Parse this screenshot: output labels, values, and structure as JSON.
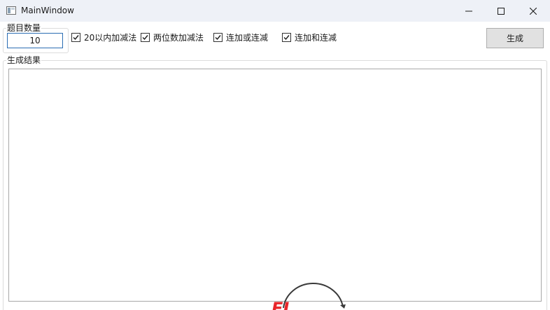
{
  "window": {
    "title": "MainWindow",
    "icon": "app-window-icon",
    "controls": [
      "minimize-icon",
      "maximize-icon",
      "close-icon"
    ]
  },
  "count_group": {
    "label": "题目数量",
    "value": "10"
  },
  "options": [
    {
      "label": "20以内加减法",
      "checked": true
    },
    {
      "label": "两位数加减法",
      "checked": true
    },
    {
      "label": "连加或连减",
      "checked": true
    },
    {
      "label": "连加和连减",
      "checked": true
    }
  ],
  "generate_button": {
    "label": "生成"
  },
  "result_group": {
    "label": "生成结果",
    "content": ""
  },
  "colors": {
    "titlebar": "#eef1f7",
    "input_border": "#2a6db3",
    "button_bg": "#e1e1e1",
    "watermark_red": "#e8262a"
  }
}
